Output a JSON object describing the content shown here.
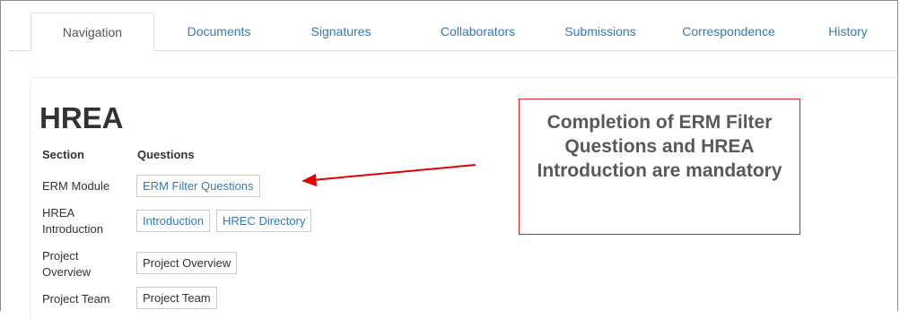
{
  "tabs": [
    {
      "label": "Navigation",
      "active": true
    },
    {
      "label": "Documents",
      "active": false
    },
    {
      "label": "Signatures",
      "active": false
    },
    {
      "label": "Collaborators",
      "active": false
    },
    {
      "label": "Submissions",
      "active": false
    },
    {
      "label": "Correspondence",
      "active": false
    },
    {
      "label": "History",
      "active": false
    }
  ],
  "page": {
    "title": "HREA",
    "col_section": "Section",
    "col_questions": "Questions"
  },
  "rows": [
    {
      "section": "ERM Module",
      "buttons": [
        "ERM Filter Questions"
      ]
    },
    {
      "section": "HREA Introduction",
      "buttons": [
        "Introduction",
        "HREC Directory"
      ]
    },
    {
      "section": "Project Overview",
      "buttons": [
        "Project Overview"
      ]
    },
    {
      "section": "Project Team",
      "buttons": [
        "Project Team"
      ]
    }
  ],
  "callout": {
    "text": "Completion of ERM Filter Questions and HREA Introduction are mandatory",
    "border_color": "#d9262b",
    "arrow_color": "#e00000"
  },
  "colors": {
    "link": "#337ab7",
    "text": "#333333"
  }
}
